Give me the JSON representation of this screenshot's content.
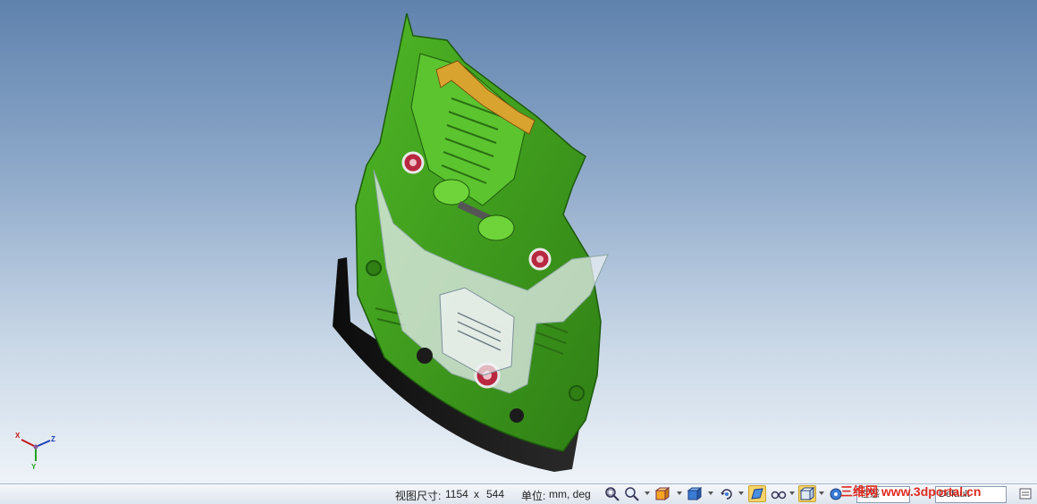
{
  "status": {
    "view_size_label": "视图尺寸:",
    "view_width": "1154",
    "view_x": "x",
    "view_height": "544",
    "units_label": "单位:",
    "units_value": "mm, deg"
  },
  "axes": {
    "x": "X",
    "y": "Y",
    "z": "Z"
  },
  "combos": {
    "left": "性感",
    "right": "Default"
  },
  "watermark": "三维网 www.3dportal.cn",
  "icons": [
    "zoom-window-icon",
    "zoom-icon",
    "view-box-icon",
    "cube-view-icon",
    "rotate-icon",
    "shaded-edges-icon",
    "glasses-icon",
    "wireframe-box-icon",
    "color-settings-icon"
  ],
  "colors": {
    "part_green": "#3c9a1e",
    "part_light_green": "#6fd43a",
    "handle_orange": "#d9a32f",
    "base_black": "#1a1a1a"
  }
}
